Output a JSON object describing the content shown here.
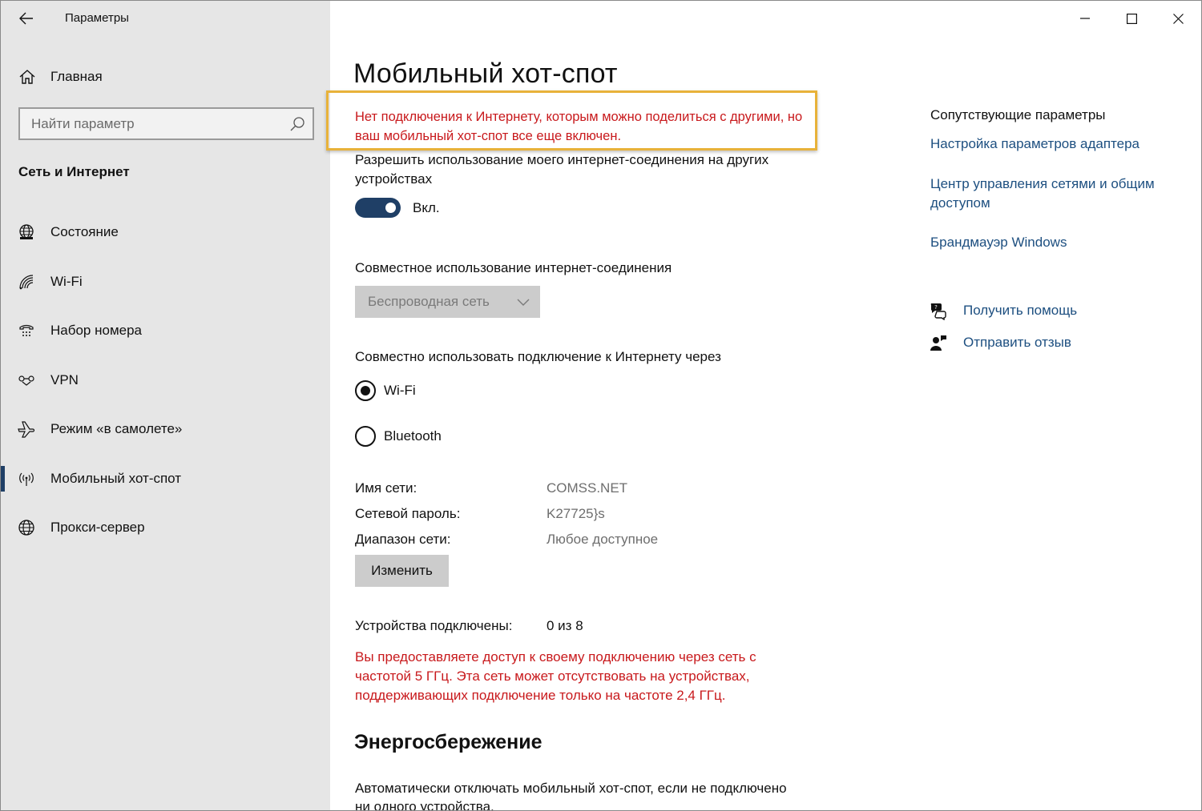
{
  "app": {
    "title": "Параметры"
  },
  "sidebar": {
    "home_label": "Главная",
    "search_placeholder": "Найти параметр",
    "section_title": "Сеть и Интернет",
    "items": [
      {
        "label": "Состояние",
        "icon": "globe-status-icon"
      },
      {
        "label": "Wi-Fi",
        "icon": "wifi-icon"
      },
      {
        "label": "Набор номера",
        "icon": "dialup-icon"
      },
      {
        "label": "VPN",
        "icon": "vpn-icon"
      },
      {
        "label": "Режим «в самолете»",
        "icon": "airplane-icon"
      },
      {
        "label": "Мобильный хот-спот",
        "icon": "hotspot-icon",
        "active": true
      },
      {
        "label": "Прокси-сервер",
        "icon": "globe-icon"
      }
    ]
  },
  "main": {
    "title": "Мобильный хот-спот",
    "warning": "Нет подключения к Интернету, которым можно поделиться с другими, но ваш мобильный хот-спот все еще включен.",
    "allow_text": "Разрешить использование моего интернет-соединения на других устройствах",
    "toggle_label": "Вкл.",
    "toggle_on": true,
    "share_label": "Совместное использование интернет-соединения",
    "share_selected": "Беспроводная сеть",
    "via_label": "Совместно использовать подключение к Интернету через",
    "radio_options": [
      {
        "label": "Wi-Fi",
        "checked": true
      },
      {
        "label": "Bluetooth",
        "checked": false
      }
    ],
    "network_name_label": "Имя сети:",
    "network_name": "COMSS.NET",
    "password_label": "Сетевой пароль:",
    "password": "K27725}s",
    "band_label": "Диапазон сети:",
    "band": "Любое доступное",
    "edit_button": "Изменить",
    "devices_label": "Устройства подключены:",
    "devices_value": "0 из 8",
    "freq_warning": "Вы предоставляете доступ к своему подключению через сеть с частотой 5 ГГц. Эта сеть может отсутствовать на устройствах, поддерживающих подключение только на частоте 2,4 ГГц.",
    "energy_title": "Энергосбережение",
    "energy_text": "Автоматически отключать мобильный хот-спот, если не подключено ни одного устройства."
  },
  "related": {
    "title": "Сопутствующие параметры",
    "links": [
      "Настройка параметров адаптера",
      "Центр управления сетями и общим доступом",
      "Брандмауэр Windows"
    ],
    "help": "Получить помощь",
    "feedback": "Отправить отзыв"
  },
  "colors": {
    "sidebar_bg": "#e6e6e6",
    "accent": "#1f3f66",
    "link": "#1d4f80",
    "warning_red": "#c8191c",
    "highlight_frame": "#e8b23a"
  }
}
